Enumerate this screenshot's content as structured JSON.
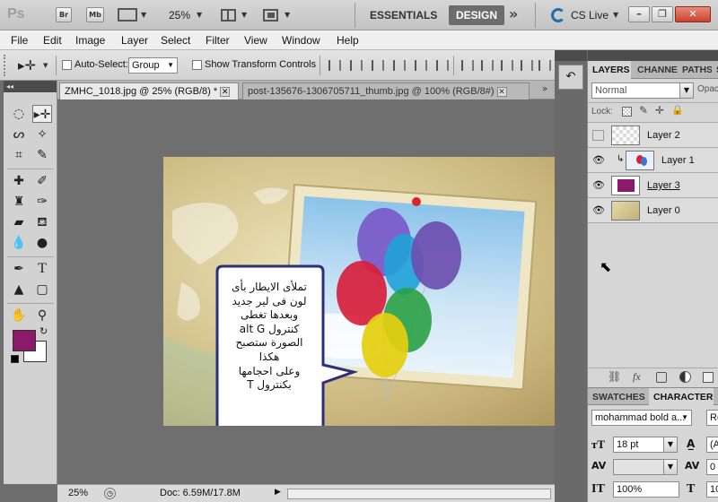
{
  "appbar": {
    "logo": "Ps",
    "bridge_label": "Br",
    "minibridge_label": "Mb",
    "zoom": "25%",
    "essentials_label": "ESSENTIALS",
    "design_label": "DESIGN",
    "more_label": "»",
    "cslive_label": "CS Live",
    "minimize": "–",
    "restore": "❐",
    "close": "✕"
  },
  "menubar": {
    "items": [
      "File",
      "Edit",
      "Image",
      "Layer",
      "Select",
      "Filter",
      "View",
      "Window",
      "Help"
    ]
  },
  "options": {
    "auto_select_label": "Auto-Select:",
    "auto_select_value": "Group",
    "show_transform_label": "Show Transform Controls"
  },
  "tabs": [
    {
      "label": "ZMHC_1018.jpg @ 25% (RGB/8) *"
    },
    {
      "label": "post-135676-1306705711_thumb.jpg @ 100% (RGB/8#)"
    }
  ],
  "callout": {
    "lines": [
      "تملأى الايطار بأى",
      "لون فى لير جديد",
      "وبعدها تغطى",
      "كنترول alt G",
      "الصورة ستصبح",
      "هكذا",
      "وعلى احجامها",
      "بكنترول T"
    ]
  },
  "status": {
    "zoom": "25%",
    "doc_info": "Doc: 6.59M/17.8M"
  },
  "layers_panel": {
    "tabs": [
      "LAYERS",
      "CHANNELS",
      "PATHS",
      "S"
    ],
    "blend_mode": "Normal",
    "opacity_label": "Opac",
    "lock_label": "Lock:",
    "layers": [
      {
        "name": "Layer 2",
        "visible": false
      },
      {
        "name": "Layer 1",
        "visible": true
      },
      {
        "name": "Layer 3",
        "visible": true
      },
      {
        "name": "Layer 0",
        "visible": true
      }
    ]
  },
  "character_panel": {
    "tabs": [
      "SWATCHES",
      "CHARACTER"
    ],
    "font_family": "mohammad bold a...",
    "font_style": "Re",
    "font_size": "18 pt",
    "leading": "(A",
    "kerning": "",
    "tracking": "0",
    "vertical_scale": "100%",
    "horizontal_scale": "10"
  },
  "colors": {
    "foreground": "#8b1a6b",
    "background": "#ffffff",
    "accent_design": "#6d6d6d"
  }
}
